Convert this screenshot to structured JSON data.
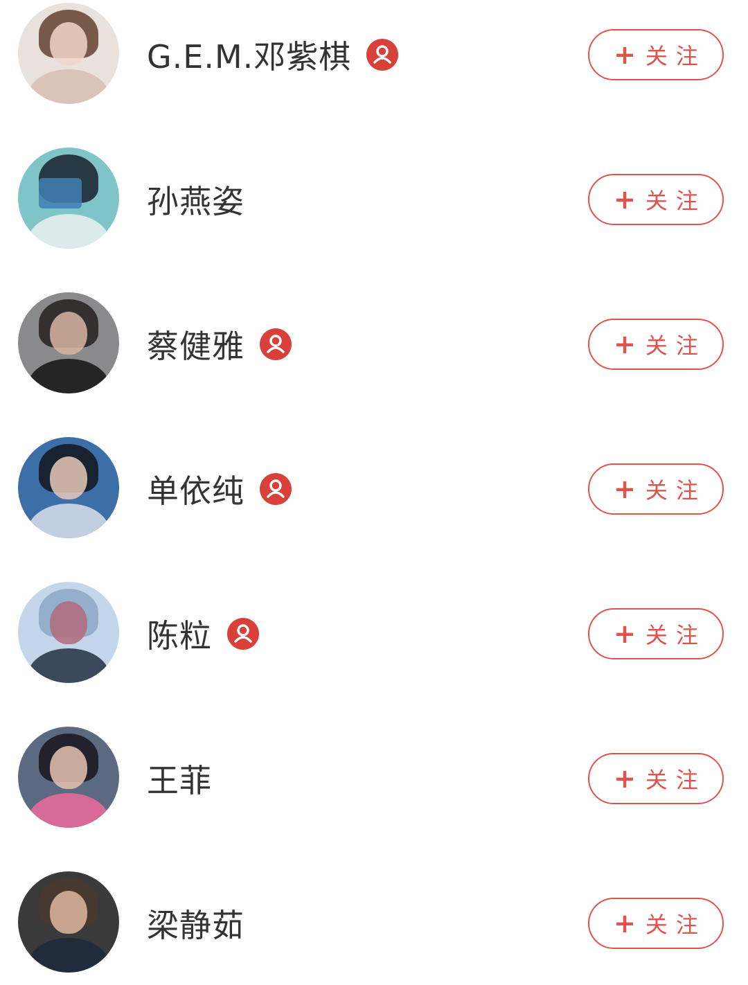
{
  "follow_button": {
    "plus": "+",
    "label": "关注"
  },
  "colors": {
    "accent": "#e0534d",
    "verified_badge": "#d9403a",
    "name_text": "#333333"
  },
  "users": [
    {
      "name": "G.E.M.邓紫棋",
      "verified": true,
      "avatar_icon": "avatar-icon"
    },
    {
      "name": "孙燕姿",
      "verified": false,
      "avatar_icon": "avatar-icon"
    },
    {
      "name": "蔡健雅",
      "verified": true,
      "avatar_icon": "avatar-icon"
    },
    {
      "name": "单依纯",
      "verified": true,
      "avatar_icon": "avatar-icon"
    },
    {
      "name": "陈粒",
      "verified": true,
      "avatar_icon": "avatar-icon"
    },
    {
      "name": "王菲",
      "verified": false,
      "avatar_icon": "avatar-icon"
    },
    {
      "name": "梁静茹",
      "verified": false,
      "avatar_icon": "avatar-icon"
    }
  ]
}
